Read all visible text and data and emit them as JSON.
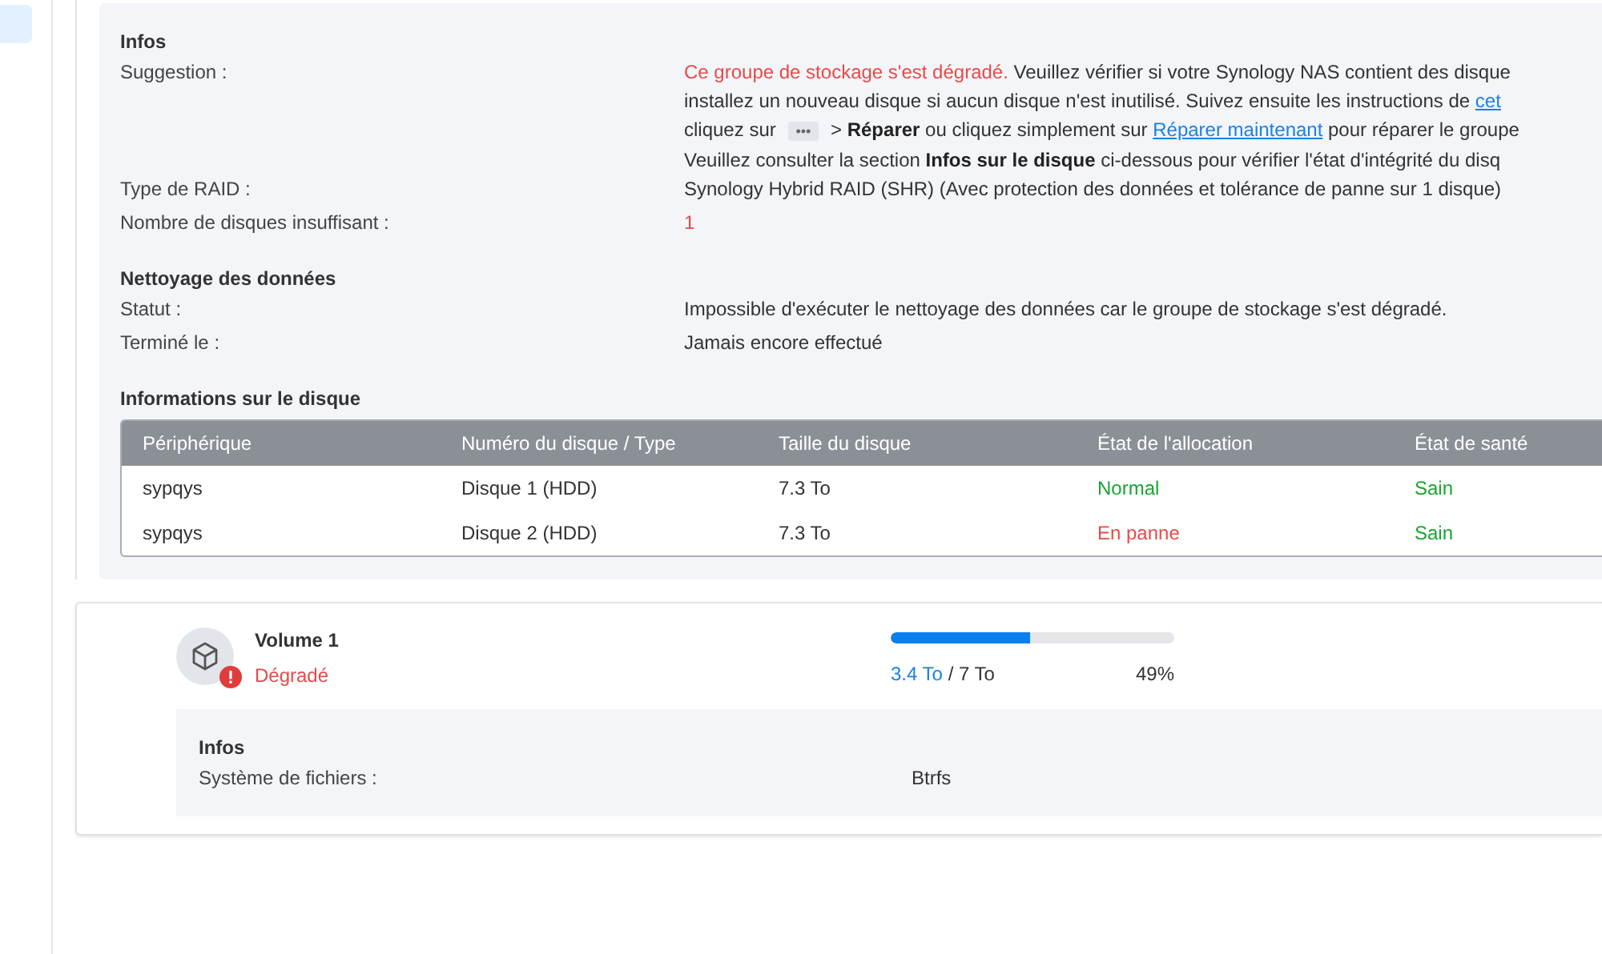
{
  "sidebar": {
    "items": [
      {
        "selected": true
      }
    ]
  },
  "pool_details": {
    "infos_title": "Infos",
    "suggestion": {
      "label": "Suggestion :",
      "lines": [
        [
          {
            "kind": "alert",
            "text": "Ce groupe de stockage s'est dégradé."
          },
          {
            "kind": "text",
            "text": " Veuillez vérifier si votre Synology NAS contient des disque"
          }
        ],
        [
          {
            "kind": "text",
            "text": "installez un nouveau disque si aucun disque n'est inutilisé. Suivez ensuite les instructions de "
          },
          {
            "kind": "link",
            "text": "cet"
          }
        ],
        [
          {
            "kind": "text",
            "text": "cliquez sur "
          },
          {
            "kind": "chip",
            "text": "•••"
          },
          {
            "kind": "text",
            "text": " > **Réparer** ou cliquez simplement sur "
          },
          {
            "kind": "link",
            "text": "Réparer maintenant"
          },
          {
            "kind": "text",
            "text": " pour réparer le groupe"
          }
        ],
        [
          {
            "kind": "text",
            "text": "Veuillez consulter la section **Infos sur le disque** ci-dessous pour vérifier l'état d'intégrité du disq"
          }
        ]
      ]
    },
    "fields": [
      {
        "label": "Type de RAID :",
        "value": "Synology Hybrid RAID (SHR) (Avec protection des données et tolérance de panne sur 1 disque)",
        "alert": false
      },
      {
        "label": "Nombre de disques insuffisant :",
        "value": "1",
        "alert": true
      }
    ],
    "scrub_title": "Nettoyage des données",
    "scrub_fields": [
      {
        "label": "Statut :",
        "value": "Impossible d'exécuter le nettoyage des données car le groupe de stockage s'est dégradé.",
        "alert": false
      },
      {
        "label": "Terminé le :",
        "value": "Jamais encore effectué",
        "alert": false
      }
    ],
    "disks_title": "Informations sur le disque",
    "table": {
      "columns": [
        "Périphérique",
        "Numéro du disque / Type",
        "Taille du disque",
        "État de l'allocation",
        "État de santé"
      ],
      "rows": [
        {
          "device": "sypqys",
          "disk": "Disque 1 (HDD)",
          "size": "7.3 To",
          "allocation": {
            "text": "Normal",
            "color": "#19a532"
          },
          "health": {
            "text": "Sain",
            "color": "#19a532"
          }
        },
        {
          "device": "sypqys",
          "disk": "Disque 2 (HDD)",
          "size": "7.3 To",
          "allocation": {
            "text": "En panne",
            "color": "#e84a4a"
          },
          "health": {
            "text": "Sain",
            "color": "#19a532"
          }
        }
      ]
    }
  },
  "volume": {
    "name": "Volume 1",
    "status": "Dégradé",
    "warning": true,
    "used": "3.4 To",
    "total": " / 7 To",
    "percent": "49%",
    "level": 0.49,
    "infos_title": "Infos",
    "fields": [
      {
        "label": "Système de fichiers :",
        "value": "Btrfs"
      }
    ]
  }
}
